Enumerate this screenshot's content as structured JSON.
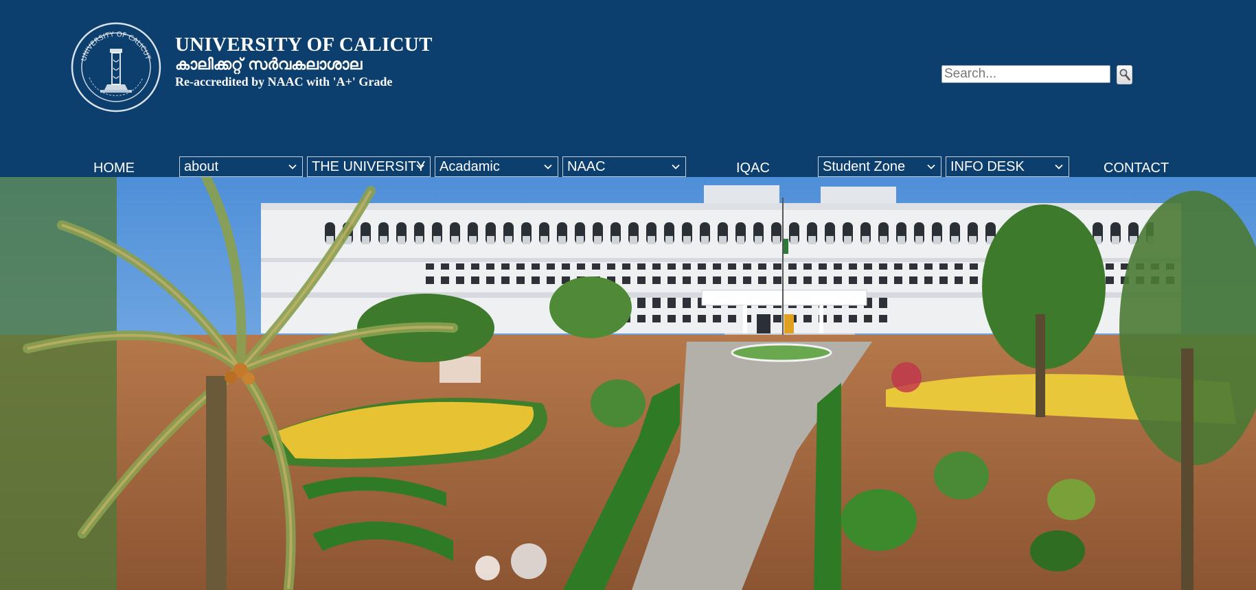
{
  "header": {
    "title": "UNIVERSITY OF CALICUT",
    "title_malayalam": "കാലിക്കറ്റ് സർവകലാശാല",
    "subtitle": "Re-accredited by NAAC with 'A+' Grade",
    "logo_seal_text": "UNIVERSITY OF CALICUT"
  },
  "search": {
    "placeholder": "Search...",
    "icon": "magnifier-icon"
  },
  "nav": {
    "home": "HOME",
    "about": "about",
    "the_university": "THE UNIVERSITY",
    "academic": "Acadamic",
    "naac": "NAAC",
    "iqac": "IQAC",
    "student_zone": "Student Zone",
    "info_desk": "INFO DESK",
    "contact": "CONTACT"
  },
  "colors": {
    "header_bg": "#0d3f6e",
    "text": "#ffffff"
  },
  "hero": {
    "image": "campus-building-photo"
  }
}
